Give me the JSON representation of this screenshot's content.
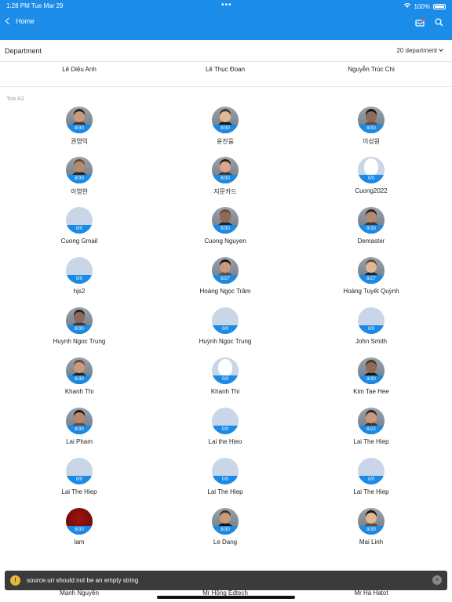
{
  "status": {
    "time": "1:28 PM   Tue Mar 29",
    "dots": "•••",
    "battery": "100%"
  },
  "nav": {
    "back_label": "Home"
  },
  "colors": {
    "accent": "#1c8ce9",
    "count_bar": "#1a8ae6"
  },
  "department": {
    "title": "Department",
    "selector": "20 department"
  },
  "previous_row": [
    "Lê Diệu Anh",
    "Lê Thục Đoan",
    "Nguyễn Trúc Chi"
  ],
  "section": {
    "label": "Toà A2"
  },
  "people": [
    {
      "name": "권영익",
      "count": "8/30",
      "photo": true
    },
    {
      "name": "윤찬웅",
      "count": "8/30",
      "photo": true
    },
    {
      "name": "이성원",
      "count": "8/30",
      "photo": true
    },
    {
      "name": "이영한",
      "count": "8/30",
      "photo": true
    },
    {
      "name": "지문카드",
      "count": "8/30",
      "photo": true
    },
    {
      "name": "Cuong2022",
      "count": "0/0",
      "photo": false,
      "silhouette": true
    },
    {
      "name": "Cuong Gmail",
      "count": "0/0",
      "photo": false
    },
    {
      "name": "Cuong Nguyen",
      "count": "8/30",
      "photo": true
    },
    {
      "name": "Demaster",
      "count": "8/30",
      "photo": true
    },
    {
      "name": "hjs2",
      "count": "0/0",
      "photo": false
    },
    {
      "name": "Hoàng Ngọc Trâm",
      "count": "8/27",
      "photo": true
    },
    {
      "name": "Hoàng Tuyết Quỳnh",
      "count": "8/27",
      "photo": true
    },
    {
      "name": "Huynh Ngoc Trung",
      "count": "8/30",
      "photo": true
    },
    {
      "name": "Huỳnh Ngọc Trung",
      "count": "0/0",
      "photo": false
    },
    {
      "name": "John Smith",
      "count": "0/0",
      "photo": false
    },
    {
      "name": "Khanh Thi",
      "count": "8/30",
      "photo": true
    },
    {
      "name": "Khanh Thi",
      "count": "0/0",
      "photo": false,
      "silhouette": true
    },
    {
      "name": "Kim Tae Hee",
      "count": "8/30",
      "photo": true
    },
    {
      "name": "Lai Pham",
      "count": "8/30",
      "photo": true
    },
    {
      "name": "Lai the Hieo",
      "count": "0/0",
      "photo": false
    },
    {
      "name": "Lai The Hiep",
      "count": "6/22",
      "photo": true
    },
    {
      "name": "Lai The Hiep",
      "count": "0/0",
      "photo": false
    },
    {
      "name": "Lai The Hiep",
      "count": "0/0",
      "photo": false
    },
    {
      "name": "Lai The Hiep",
      "count": "0/0",
      "photo": false
    },
    {
      "name": "lam",
      "count": "6/30",
      "photo": true,
      "dark_red": true
    },
    {
      "name": "Le Dang",
      "count": "8/30",
      "photo": true
    },
    {
      "name": "Mai Linh",
      "count": "8/30",
      "photo": true
    }
  ],
  "partial_row": [
    "Mạnh Nguyễn",
    "Mr Hồng Edtech",
    "Mr Hà Hatot"
  ],
  "toast": {
    "icon": "!",
    "message": "source.uri should not be an empty string",
    "close": "×"
  }
}
